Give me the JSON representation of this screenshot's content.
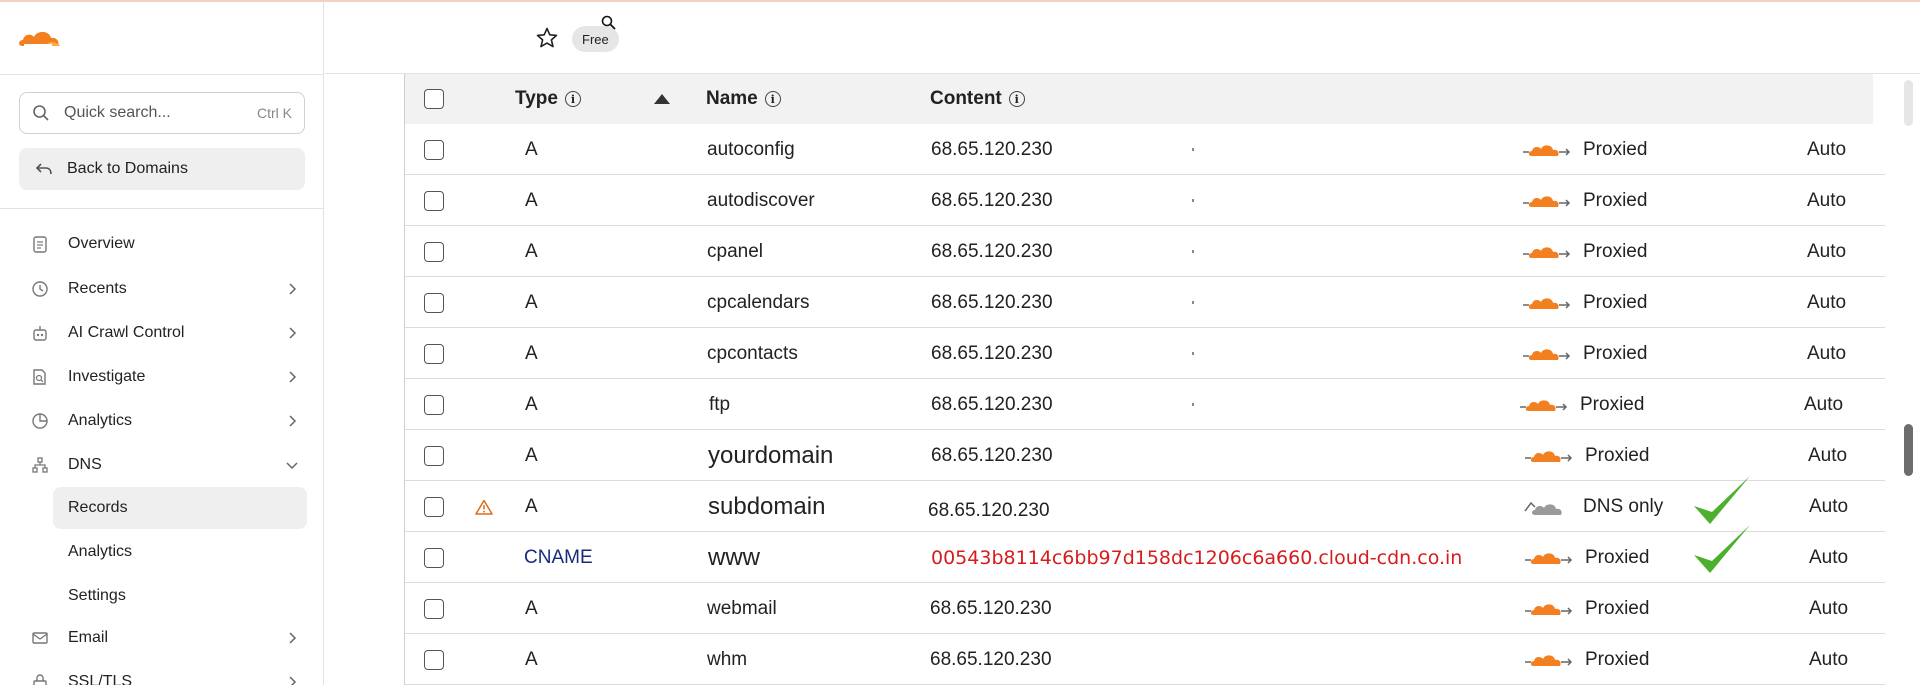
{
  "colors": {
    "accent": "#f38020",
    "proxied_orange": "#f38020",
    "dns_only_gray": "#9a9a9a",
    "error_red": "#d61d1d",
    "cname_blue": "#1a2a7a",
    "check_green": "#4caf2e"
  },
  "sidebar": {
    "search": {
      "placeholder": "Quick search...",
      "shortcut": "Ctrl K"
    },
    "back_label": "Back to Domains",
    "nav": [
      {
        "label": "Overview",
        "icon": "clipboard-icon"
      },
      {
        "label": "Recents",
        "icon": "history-icon"
      },
      {
        "label": "AI Crawl Control",
        "icon": "robot-icon"
      },
      {
        "label": "Investigate",
        "icon": "document-search-icon"
      },
      {
        "label": "Analytics",
        "icon": "pie-chart-icon"
      },
      {
        "label": "DNS",
        "icon": "network-icon"
      },
      {
        "label": "Email",
        "icon": "mail-icon"
      },
      {
        "label": "SSL/TLS",
        "icon": "lock-icon"
      }
    ],
    "dns_sub": [
      {
        "label": "Records"
      },
      {
        "label": "Analytics"
      },
      {
        "label": "Settings"
      }
    ]
  },
  "header": {
    "plan_badge": "Free"
  },
  "table": {
    "columns": {
      "type": "Type",
      "name": "Name",
      "content": "Content"
    },
    "rows": [
      {
        "type": "A",
        "name": "autoconfig",
        "content": "68.65.120.230",
        "proxy": "Proxied",
        "ttl": "Auto"
      },
      {
        "type": "A",
        "name": "autodiscover",
        "content": "68.65.120.230",
        "proxy": "Proxied",
        "ttl": "Auto"
      },
      {
        "type": "A",
        "name": "cpanel",
        "content": "68.65.120.230",
        "proxy": "Proxied",
        "ttl": "Auto"
      },
      {
        "type": "A",
        "name": "cpcalendars",
        "content": "68.65.120.230",
        "proxy": "Proxied",
        "ttl": "Auto"
      },
      {
        "type": "A",
        "name": "cpcontacts",
        "content": "68.65.120.230",
        "proxy": "Proxied",
        "ttl": "Auto"
      },
      {
        "type": "A",
        "name": "ftp",
        "content": "68.65.120.230",
        "proxy": "Proxied",
        "ttl": "Auto"
      },
      {
        "type": "A",
        "name": "yourdomain",
        "content": "68.65.120.230",
        "proxy": "Proxied",
        "ttl": "Auto"
      },
      {
        "type": "A",
        "name": "subdomain",
        "content": "68.65.120.230",
        "proxy": "DNS only",
        "ttl": "Auto"
      },
      {
        "type": "CNAME",
        "name": "www",
        "content": "00543b8114c6bb97d158dc1206c6a660.cloud-cdn.co.in",
        "proxy": "Proxied",
        "ttl": "Auto"
      },
      {
        "type": "A",
        "name": "webmail",
        "content": "68.65.120.230",
        "proxy": "Proxied",
        "ttl": "Auto"
      },
      {
        "type": "A",
        "name": "whm",
        "content": "68.65.120.230",
        "proxy": "Proxied",
        "ttl": "Auto"
      }
    ]
  }
}
